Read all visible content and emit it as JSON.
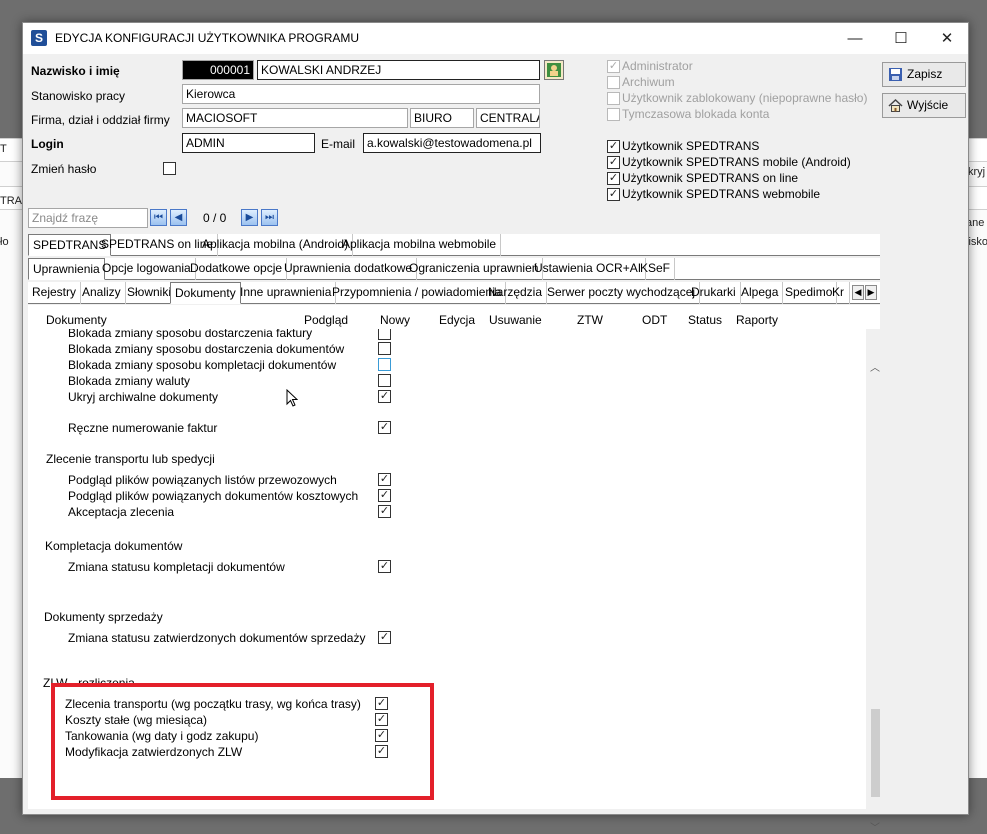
{
  "background": {
    "strip_texts": [
      "T",
      "TRAN",
      "ło",
      "kryj",
      "ane",
      "lisko"
    ]
  },
  "window": {
    "title": "EDYCJA KONFIGURACJI UŻYTKOWNIKA PROGRAMU",
    "app_icon_glyph": "S",
    "controls": {
      "minimize": "—",
      "maximize": "☐",
      "close": "✕"
    }
  },
  "form": {
    "name_label": "Nazwisko i imię",
    "user_id": "000001",
    "user_name": "KOWALSKI ANDRZEJ",
    "position_label": "Stanowisko pracy",
    "position_value": "Kierowca",
    "company_label": "Firma, dział i oddział firmy",
    "company_value": "MACIOSOFT",
    "department_value": "BIURO",
    "branch_value": "CENTRALA",
    "login_label": "Login",
    "login_value": "ADMIN",
    "email_label": "E-mail",
    "email_value": "a.kowalski@testowadomena.pl",
    "change_password_label": "Zmień hasło"
  },
  "flags": [
    {
      "label": "Administrator",
      "checked": true,
      "disabled": true
    },
    {
      "label": "Archiwum",
      "checked": false,
      "disabled": true
    },
    {
      "label": "Użytkownik zablokowany (niepoprawne hasło)",
      "checked": false,
      "disabled": true
    },
    {
      "label": "Tymczasowa blokada konta",
      "checked": false,
      "disabled": true
    }
  ],
  "user_types": [
    {
      "label": "Użytkownik SPEDTRANS",
      "checked": true
    },
    {
      "label": "Użytkownik SPEDTRANS mobile (Android)",
      "checked": true
    },
    {
      "label": "Użytkownik SPEDTRANS on line",
      "checked": true
    },
    {
      "label": "Użytkownik SPEDTRANS webmobile",
      "checked": true
    }
  ],
  "buttons": {
    "save": "Zapisz",
    "exit": "Wyjście"
  },
  "search": {
    "placeholder": "Znajdź frazę",
    "counter": "0 / 0"
  },
  "tabs_row1": [
    "SPEDTRANS",
    "SPEDTRANS on line",
    "Aplikacja mobilna (Android)",
    "Aplikacja mobilna webmobile"
  ],
  "tabs_row2": [
    "Uprawnienia",
    "Opcje logowania",
    "Dodatkowe opcje",
    "Uprawnienia dodatkowe",
    "Ograniczenia uprawnień",
    "Ustawienia OCR+AI",
    "KSeF"
  ],
  "tabs_row3": [
    "Rejestry",
    "Analizy",
    "Słowniki",
    "Dokumenty",
    "Inne uprawnienia",
    "Przypomnienia / powiadomienia",
    "Narzędzia",
    "Serwer poczty wychodzącej",
    "Drukarki",
    "Alpega",
    "Spedimo",
    "Kr"
  ],
  "grid": {
    "columns": [
      "Dokumenty",
      "Podgląd",
      "Nowy",
      "Edycja",
      "Usuwanie",
      "ZTW",
      "ODT",
      "Status",
      "Raporty"
    ],
    "rows": [
      {
        "label": "Blokada zmiany sposobu dostarczenia faktury",
        "checked": false
      },
      {
        "label": "Blokada zmiany sposobu dostarczenia dokumentów",
        "checked": false
      },
      {
        "label": "Blokada zmiany sposobu kompletacji dokumentów",
        "checked": false
      },
      {
        "label": "Blokada zmiany waluty",
        "checked": false
      },
      {
        "label": "Ukryj archiwalne dokumenty",
        "checked": true
      },
      {
        "label": "Ręczne numerowanie faktur",
        "checked": true
      },
      {
        "label": "Zlecenie transportu lub spedycji"
      },
      {
        "label": "Podgląd plików powiązanych listów przewozowych",
        "checked": true
      },
      {
        "label": "Podgląd plików powiązanych dokumentów kosztowych",
        "checked": true
      },
      {
        "label": "Akceptacja zlecenia",
        "checked": true
      },
      {
        "label": "Kompletacja dokumentów"
      },
      {
        "label": "Zmiana statusu kompletacji dokumentów",
        "checked": true
      },
      {
        "label": "Dokumenty sprzedaży"
      },
      {
        "label": "Zmiana statusu zatwierdzonych dokumentów sprzedaży",
        "checked": true
      },
      {
        "label": "ZLW - rozliczenia"
      },
      {
        "label": "Zlecenia transportu (wg początku trasy, wg końca trasy)",
        "checked": true
      },
      {
        "label": "Koszty stałe (wg miesiąca)",
        "checked": true
      },
      {
        "label": "Tankowania (wg daty i godz zakupu)",
        "checked": true
      },
      {
        "label": "Modyfikacja zatwierdzonych ZLW",
        "checked": true
      }
    ]
  },
  "colors": {
    "highlight_border": "#e3202a",
    "accent": "#1f4e98"
  }
}
